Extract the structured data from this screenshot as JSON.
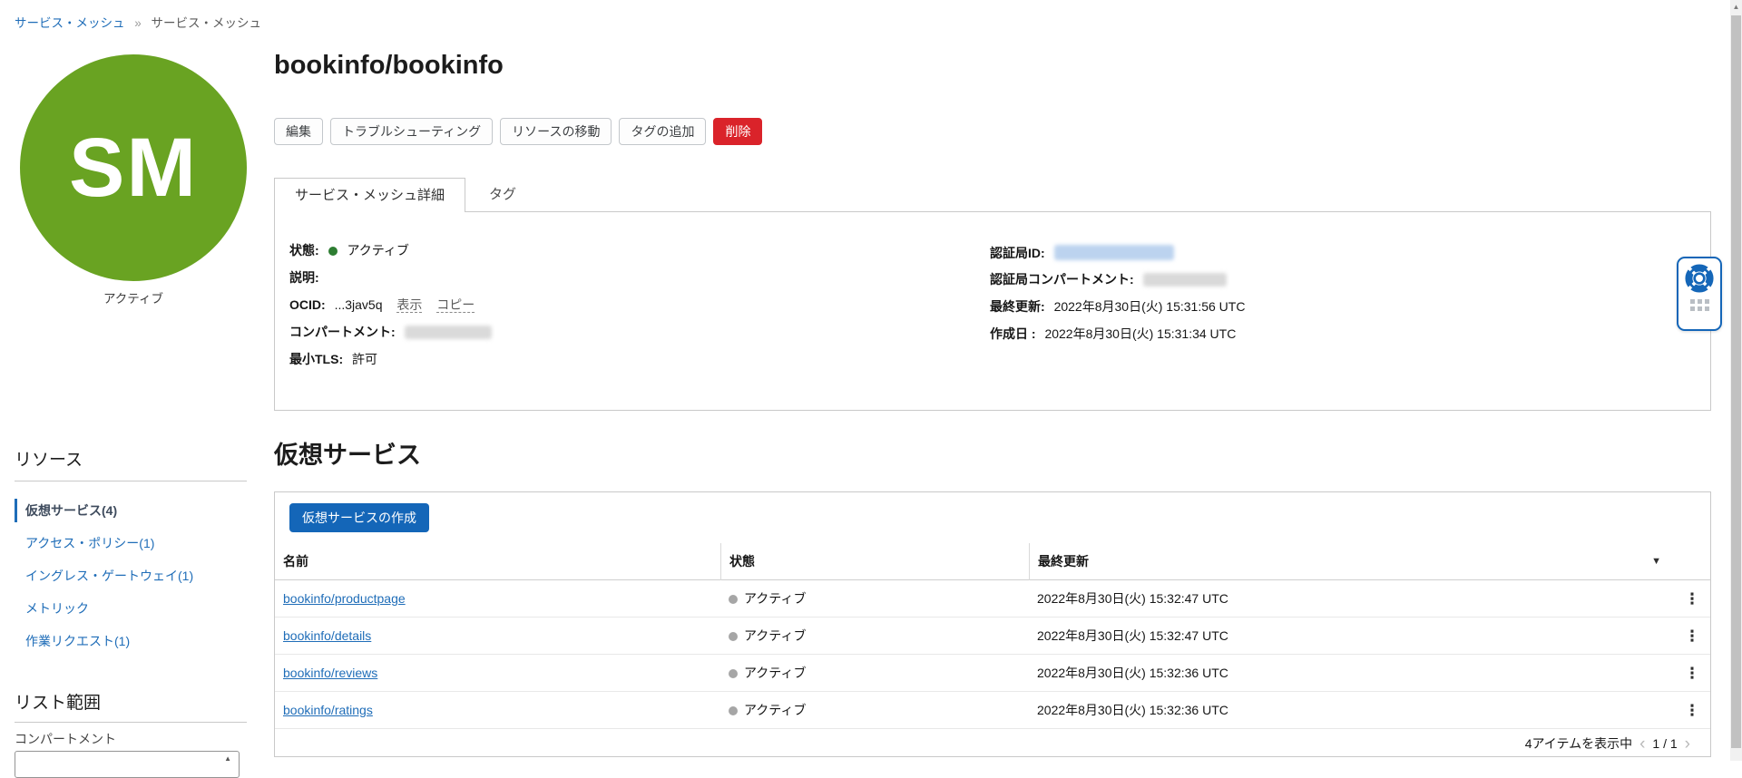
{
  "breadcrumb": {
    "link": "サービス・メッシュ",
    "separator": "»",
    "current": "サービス・メッシュ"
  },
  "entity": {
    "initials": "SM",
    "status_caption": "アクティブ",
    "title": "bookinfo/bookinfo"
  },
  "actions": {
    "edit": "編集",
    "troubleshoot": "トラブルシューティング",
    "move_resource": "リソースの移動",
    "add_tags": "タグの追加",
    "delete": "削除"
  },
  "tabs": {
    "details": "サービス・メッシュ詳細",
    "tags": "タグ"
  },
  "details": {
    "status_label": "状態:",
    "status_value": "アクティブ",
    "description_label": "説明:",
    "ocid_label": "OCID:",
    "ocid_value": "...3jav5q",
    "show_link": "表示",
    "copy_link": "コピー",
    "compartment_label": "コンパートメント:",
    "min_tls_label": "最小TLS:",
    "min_tls_value": "許可",
    "ca_id_label": "認証局ID:",
    "ca_compartment_label": "認証局コンパートメント:",
    "updated_label": "最終更新:",
    "updated_value": "2022年8月30日(火) 15:31:56 UTC",
    "created_label": "作成日 :",
    "created_value": "2022年8月30日(火) 15:31:34 UTC"
  },
  "sidebar": {
    "resources_heading": "リソース",
    "items": [
      {
        "label": "仮想サービス(4)"
      },
      {
        "label": "アクセス・ポリシー(1)"
      },
      {
        "label": "イングレス・ゲートウェイ(1)"
      },
      {
        "label": "メトリック"
      },
      {
        "label": "作業リクエスト(1)"
      }
    ],
    "list_scope_heading": "リスト範囲",
    "compartment_label": "コンパートメント"
  },
  "virtual_services": {
    "heading": "仮想サービス",
    "create_button": "仮想サービスの作成",
    "columns": {
      "name": "名前",
      "state": "状態",
      "updated": "最終更新"
    },
    "sort_icon": "▼",
    "rows": [
      {
        "name": "bookinfo/productpage",
        "state": "アクティブ",
        "updated": "2022年8月30日(火) 15:32:47 UTC"
      },
      {
        "name": "bookinfo/details",
        "state": "アクティブ",
        "updated": "2022年8月30日(火) 15:32:47 UTC"
      },
      {
        "name": "bookinfo/reviews",
        "state": "アクティブ",
        "updated": "2022年8月30日(火) 15:32:36 UTC"
      },
      {
        "name": "bookinfo/ratings",
        "state": "アクティブ",
        "updated": "2022年8月30日(火) 15:32:36 UTC"
      }
    ],
    "kebab": "⋮",
    "pagination": {
      "summary": "4アイテムを表示中",
      "prev": "‹",
      "page": "1 / 1",
      "next": "›"
    }
  },
  "colors": {
    "link_blue": "#1f6db8",
    "primary_button_blue": "#1466b8",
    "danger_red": "#da232a",
    "entity_green": "#69a322",
    "status_green": "#2e7d32",
    "status_gray": "#a6a6a6"
  }
}
